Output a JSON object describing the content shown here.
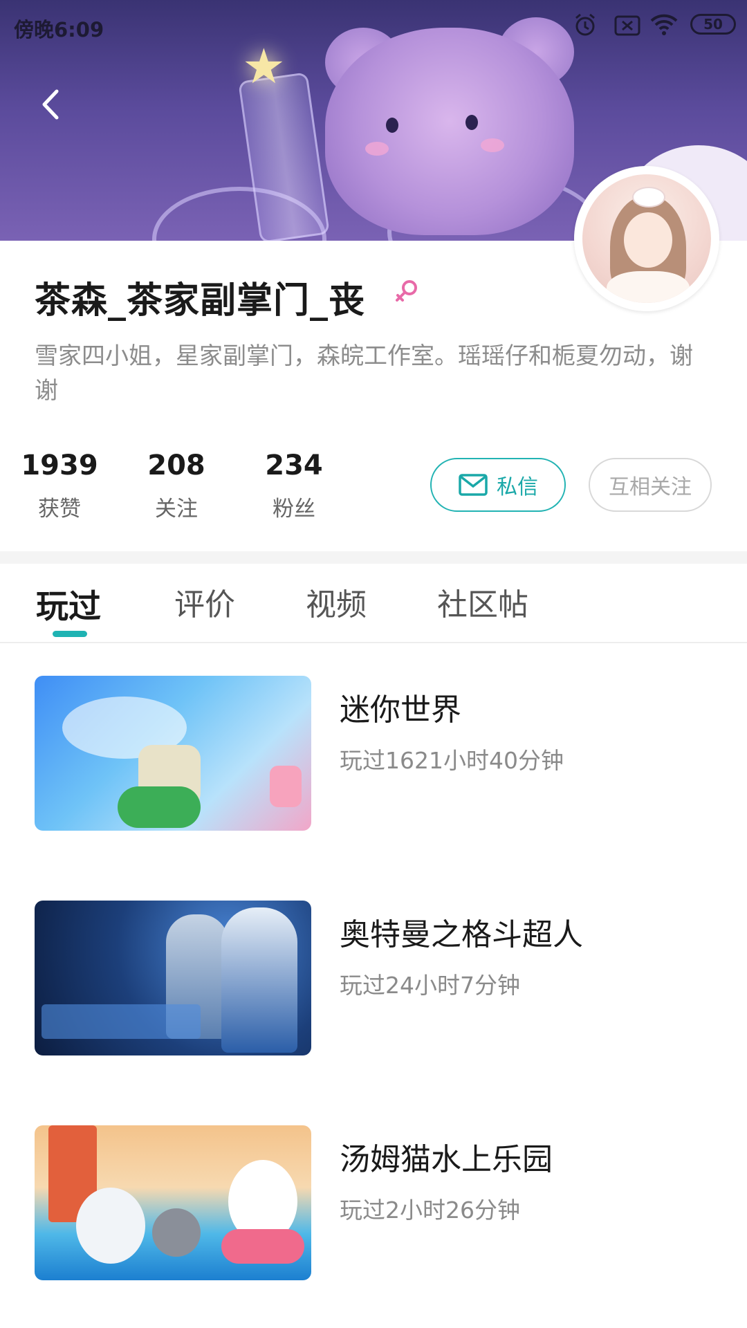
{
  "status_bar": {
    "time": "傍晚6:09",
    "battery": "50"
  },
  "profile": {
    "name": "茶森_茶家副掌门_丧",
    "bio": "雪家四小姐，星家副掌门，森皖工作室。瑶瑶仔和栀夏勿动，谢谢",
    "stats": [
      {
        "value": "1939",
        "label": "获赞"
      },
      {
        "value": "208",
        "label": "关注"
      },
      {
        "value": "234",
        "label": "粉丝"
      }
    ],
    "message_button": "私信",
    "follow_button": "互相关注"
  },
  "tabs": [
    "玩过",
    "评价",
    "视频",
    "社区帖"
  ],
  "active_tab": "玩过",
  "games": [
    {
      "title": "迷你世界",
      "playtime": "玩过1621小时40分钟"
    },
    {
      "title": "奥特曼之格斗超人",
      "playtime": "玩过24小时7分钟"
    },
    {
      "title": "汤姆猫水上乐园",
      "playtime": "玩过2小时26分钟"
    }
  ],
  "colors": {
    "accent": "#1fb3b3",
    "gender_icon": "#e86aa8",
    "banner": "#5b4b9c"
  }
}
